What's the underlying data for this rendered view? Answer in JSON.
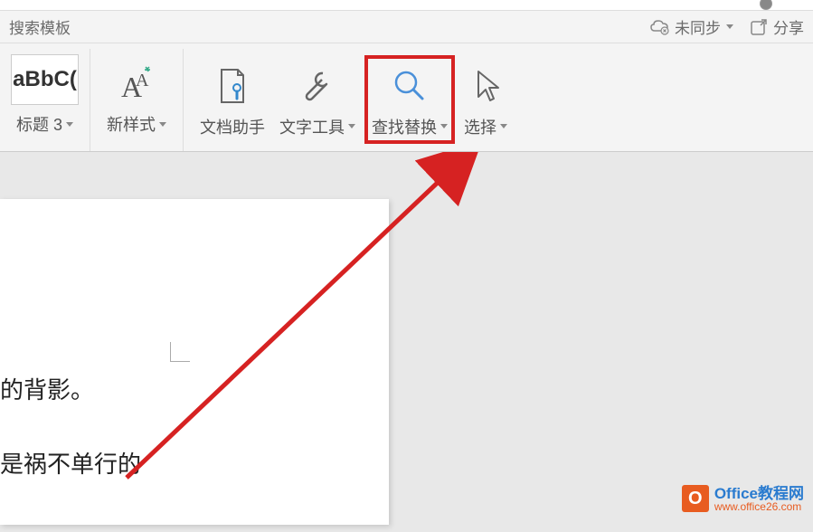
{
  "topbar": {},
  "subbar": {
    "search_placeholder": "搜索模板",
    "sync_label": "未同步",
    "share_label": "分享"
  },
  "ribbon": {
    "style_preview_text": "aBbC(",
    "style_preview_label": "标题 3",
    "new_style_label": "新样式",
    "doc_helper_label": "文档助手",
    "text_tool_label": "文字工具",
    "find_replace_label": "查找替换",
    "select_label": "选择"
  },
  "document": {
    "line1": "的背影。",
    "line2": "是祸不单行的"
  },
  "watermark": {
    "badge_letter": "O",
    "title": "Office教程网",
    "url": "www.office26.com"
  }
}
